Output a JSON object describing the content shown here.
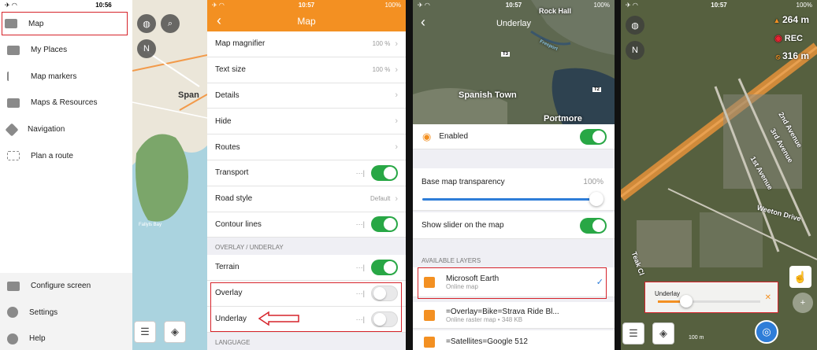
{
  "status": {
    "p1_time": "10:56",
    "p2_time": "10:57",
    "p3_time": "10:57",
    "p4_time": "10:57",
    "battery": "100%"
  },
  "panel1": {
    "menu": [
      {
        "label": "Map",
        "icon": "layers-icon"
      },
      {
        "label": "My Places",
        "icon": "star-icon"
      },
      {
        "label": "Map markers",
        "icon": "flag-icon"
      },
      {
        "label": "Maps & Resources",
        "icon": "folder-icon"
      },
      {
        "label": "Navigation",
        "icon": "navigation-icon"
      },
      {
        "label": "Plan a route",
        "icon": "route-icon"
      }
    ],
    "bottom_menu": [
      {
        "label": "Configure screen",
        "icon": "configure-icon"
      },
      {
        "label": "Settings",
        "icon": "gear-icon"
      },
      {
        "label": "Help",
        "icon": "help-icon"
      }
    ],
    "map_label": "Span",
    "map_label2": "Fallyls Bay"
  },
  "panel2": {
    "title": "Map",
    "rows": [
      {
        "label": "Map magnifier",
        "value": "100 %",
        "type": "chevron"
      },
      {
        "label": "Text size",
        "value": "100 %",
        "type": "chevron"
      },
      {
        "label": "Details",
        "value": "",
        "type": "chevron"
      },
      {
        "label": "Hide",
        "value": "",
        "type": "chevron"
      },
      {
        "label": "Routes",
        "value": "",
        "type": "chevron"
      },
      {
        "label": "Transport",
        "value": "",
        "type": "toggle-on"
      },
      {
        "label": "Road style",
        "value": "Default",
        "type": "chevron"
      },
      {
        "label": "Contour lines",
        "value": "",
        "type": "toggle-on"
      }
    ],
    "section_overlay": "OVERLAY / UNDERLAY",
    "overlay_rows": [
      {
        "label": "Terrain",
        "type": "toggle-on"
      },
      {
        "label": "Overlay",
        "type": "toggle-off"
      },
      {
        "label": "Underlay",
        "type": "toggle-off"
      }
    ],
    "section_language": "LANGUAGE"
  },
  "panel3": {
    "title": "Underlay",
    "map_labels": {
      "town": "Spanish Town",
      "portmore": "Portmore",
      "hall": "Rock Hall",
      "freeport": "Freeport",
      "t3": "T3",
      "t2": "T2"
    },
    "enabled_label": "Enabled",
    "transparency_label": "Base map transparency",
    "transparency_value": "100%",
    "transparency_fraction": 1.0,
    "show_slider_label": "Show slider on the map",
    "section_layers": "AVAILABLE LAYERS",
    "layers": [
      {
        "name": "Microsoft Earth",
        "sub": "Online map",
        "selected": true
      },
      {
        "name": "=Overlay=Bike=Strava Ride Bl...",
        "sub": "Online raster map • 348 KB",
        "selected": false
      },
      {
        "name": "=Satellites=Google 512",
        "sub": "",
        "selected": false
      }
    ]
  },
  "panel4": {
    "altitude": "264 m",
    "rec": "REC",
    "distance": "316 m",
    "roads": [
      "2nd Avenue",
      "1st Avenue",
      "3rd Avenue",
      "Weeton Drive",
      "Teak Cl"
    ],
    "underlay_label": "Underlay",
    "slider_fraction": 0.28,
    "scale_label": "100 m"
  }
}
